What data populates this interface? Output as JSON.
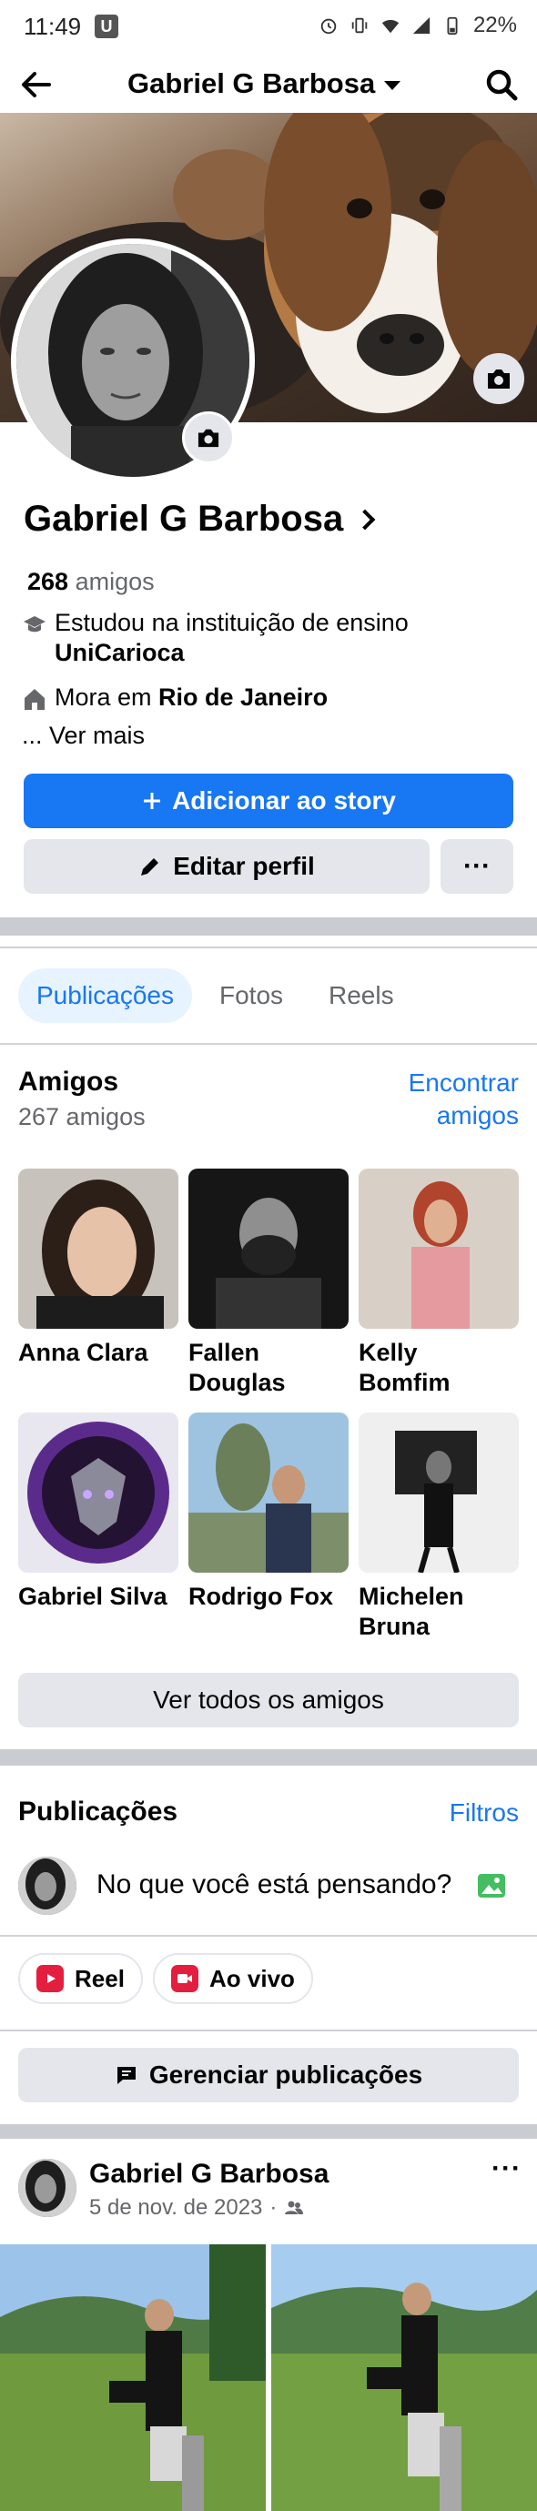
{
  "status_bar": {
    "time": "11:49",
    "app_badge": "U",
    "battery": "22%"
  },
  "top_bar": {
    "title": "Gabriel G Barbosa",
    "back_icon": "arrow-left-icon",
    "search_icon": "search-icon"
  },
  "profile": {
    "name": "Gabriel G Barbosa",
    "friends_count": "268",
    "friends_label": "amigos",
    "education_prefix": "Estudou na instituição de ensino",
    "education_place": "UniCarioca",
    "lives_prefix": "Mora em",
    "lives_place": "Rio de Janeiro",
    "see_more": "... Ver mais"
  },
  "actions": {
    "add_story": "Adicionar ao story",
    "edit_profile": "Editar perfil",
    "more": "···"
  },
  "tabs": [
    {
      "label": "Publicações",
      "active": true
    },
    {
      "label": "Fotos",
      "active": false
    },
    {
      "label": "Reels",
      "active": false
    }
  ],
  "friends_section": {
    "title": "Amigos",
    "subtitle": "267 amigos",
    "find_link_line1": "Encontrar",
    "find_link_line2": "amigos",
    "friends": [
      {
        "name_line1": "Anna Clara",
        "name_line2": ""
      },
      {
        "name_line1": "Fallen",
        "name_line2": "Douglas"
      },
      {
        "name_line1": "Kelly",
        "name_line2": "Bomfim"
      },
      {
        "name_line1": "Gabriel Silva",
        "name_line2": ""
      },
      {
        "name_line1": "Rodrigo Fox",
        "name_line2": ""
      },
      {
        "name_line1": "Michelen",
        "name_line2": "Bruna"
      }
    ],
    "see_all": "Ver todos os amigos"
  },
  "posts_section": {
    "title": "Publicações",
    "filters": "Filtros",
    "composer_placeholder": "No que você está pensando?",
    "reel_label": "Reel",
    "live_label": "Ao vivo",
    "manage_posts": "Gerenciar publicações"
  },
  "post": {
    "author": "Gabriel G Barbosa",
    "date": "5 de nov. de 2023",
    "separator": "·",
    "more": "···"
  },
  "colors": {
    "accent": "#1877f2",
    "secondary_text": "#65676b",
    "button_grey": "#e4e6eb",
    "reel_pink": "#e41e3f",
    "photo_green": "#45bd62"
  }
}
